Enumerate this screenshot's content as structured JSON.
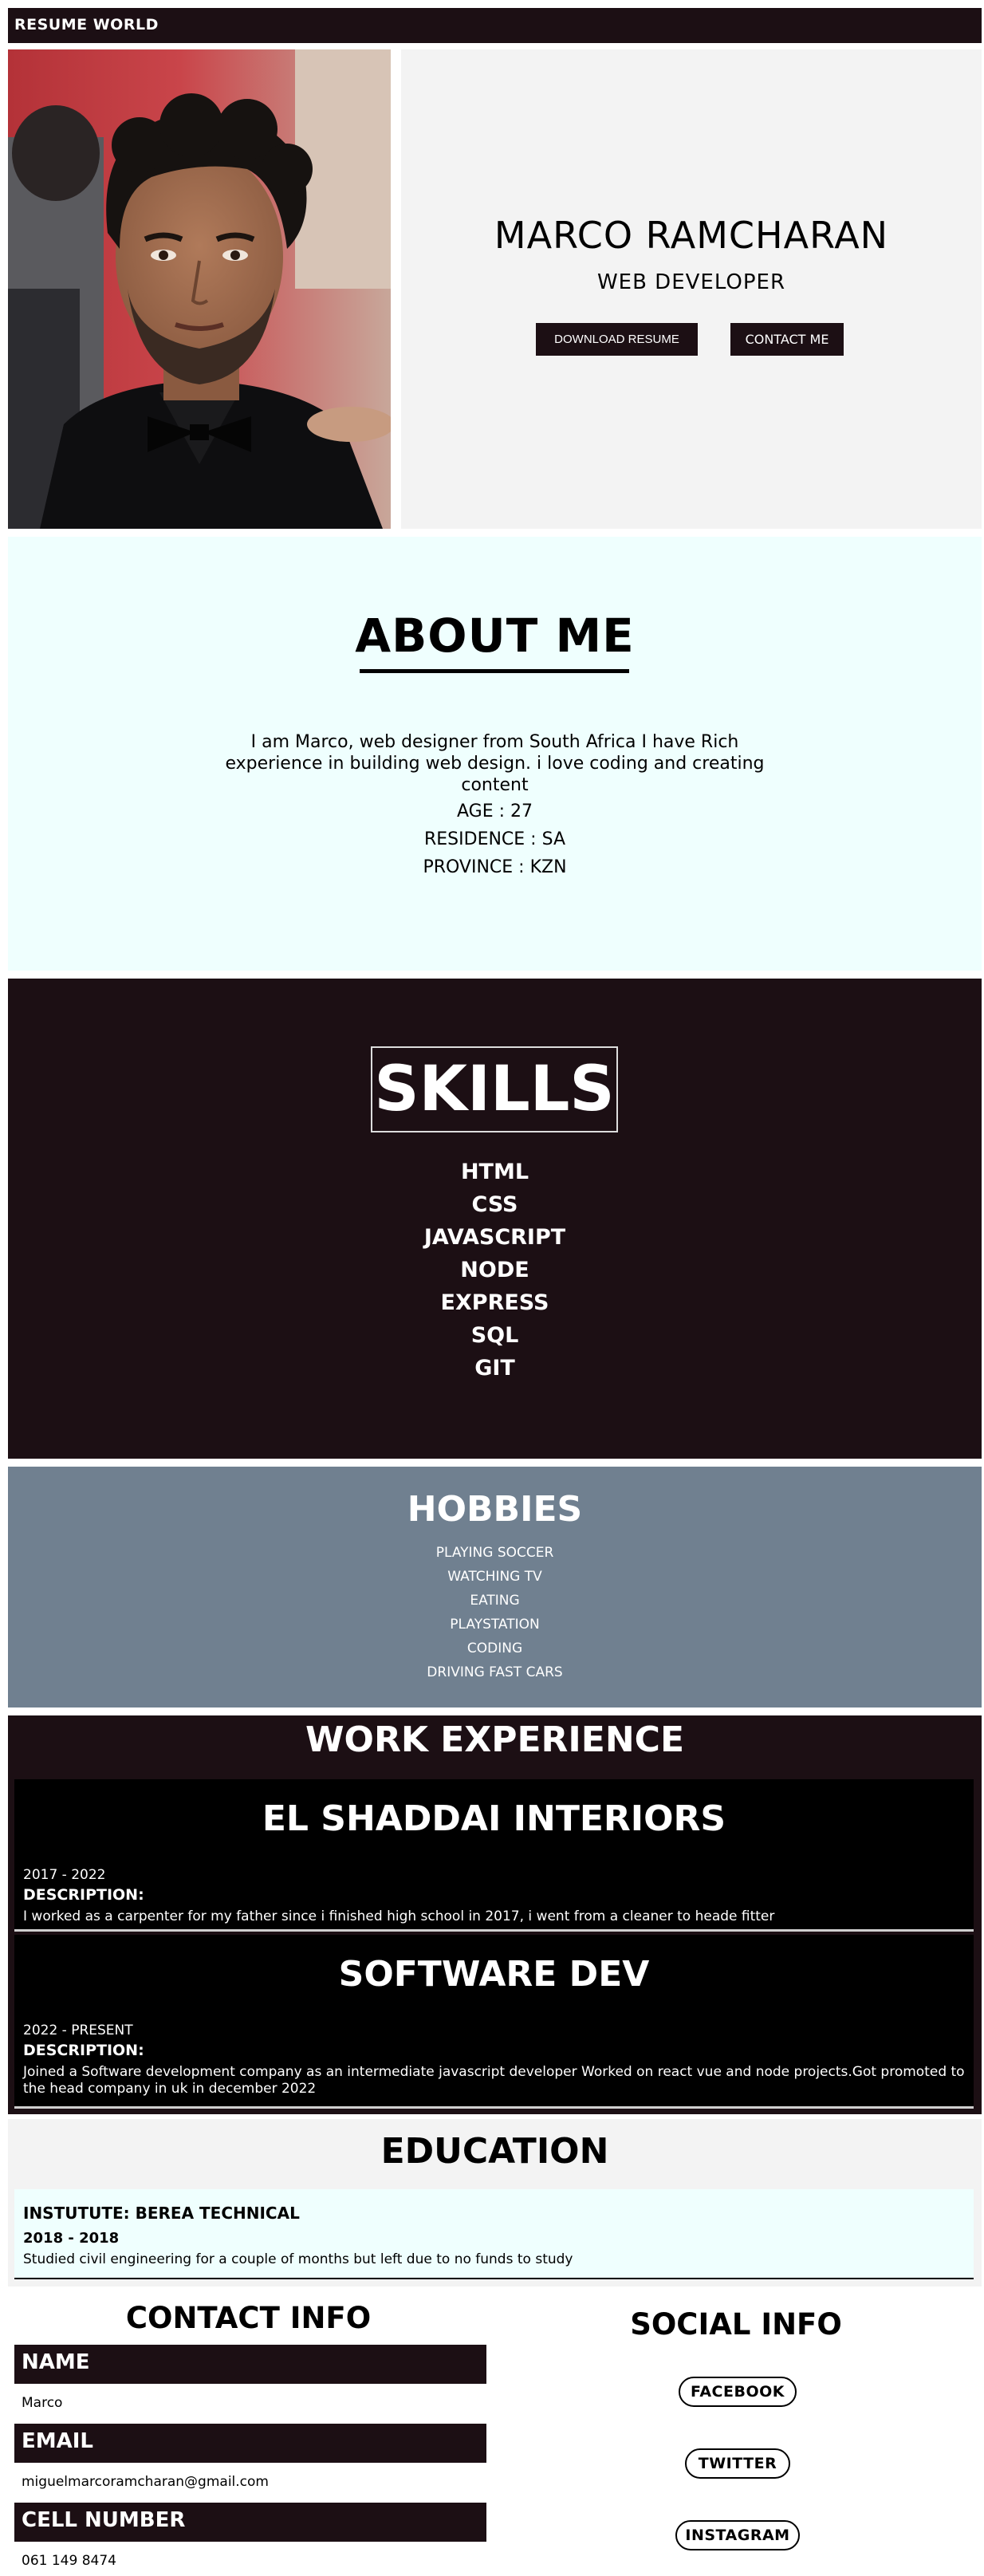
{
  "header": {
    "brand": "RESUME WORLD"
  },
  "hero": {
    "name": "MARCO RAMCHARAN",
    "title": "WEB DEVELOPER",
    "download_label": "DOWNLOAD RESUME",
    "contact_label": "CONTACT ME"
  },
  "about": {
    "heading": "ABOUT ME",
    "description": "I am Marco, web designer from South Africa I have Rich experience in building web design. i love coding and creating content",
    "age": "AGE : 27",
    "residence": "RESIDENCE : SA",
    "province": "PROVINCE : KZN"
  },
  "skills": {
    "heading": "SKILLS",
    "items": [
      "HTML",
      "CSS",
      "JAVASCRIPT",
      "NODE",
      "EXPRESS",
      "SQL",
      "GIT"
    ]
  },
  "hobbies": {
    "heading": "HOBBIES",
    "items": [
      "PLAYING SOCCER",
      "WATCHING TV",
      "EATING",
      "PLAYSTATION",
      "CODING",
      "DRIVING FAST CARS"
    ]
  },
  "work": {
    "heading": "WORK EXPERIENCE",
    "jobs": [
      {
        "company": "EL SHADDAI INTERIORS",
        "period": "2017 - 2022",
        "description_label": "DESCRIPTION:",
        "description": "I worked as a carpenter for my father since i finished high school in 2017, i went from a cleaner to heade fitter"
      },
      {
        "company": "SOFTWARE DEV",
        "period": "2022 - PRESENT",
        "description_label": "DESCRIPTION:",
        "description": "Joined a Software development company as an intermediate javascript developer Worked on react vue and node projects.Got promoted to the head company in uk in december 2022"
      }
    ]
  },
  "education": {
    "heading": "EDUCATION",
    "school": "INSTUTUTE: BEREA TECHNICAL",
    "period": "2018 - 2018",
    "description": "Studied civil engineering for a couple of months but left due to no funds to study"
  },
  "contact": {
    "heading": "CONTACT INFO",
    "name_label": "NAME",
    "name_value": "Marco",
    "email_label": "EMAIL",
    "email_value": "miguelmarcoramcharan@gmail.com",
    "cell_label": "CELL NUMBER",
    "cell_value": "061 149 8474"
  },
  "social": {
    "heading": "SOCIAL INFO",
    "facebook": "FACEBOOK",
    "twitter": "TWITTER",
    "instagram": "INSTAGRAM"
  },
  "colors": {
    "dark": "#1c0f14",
    "light_cyan": "#effffe",
    "slate": "#708090",
    "light_gray": "#f3f3f3"
  }
}
